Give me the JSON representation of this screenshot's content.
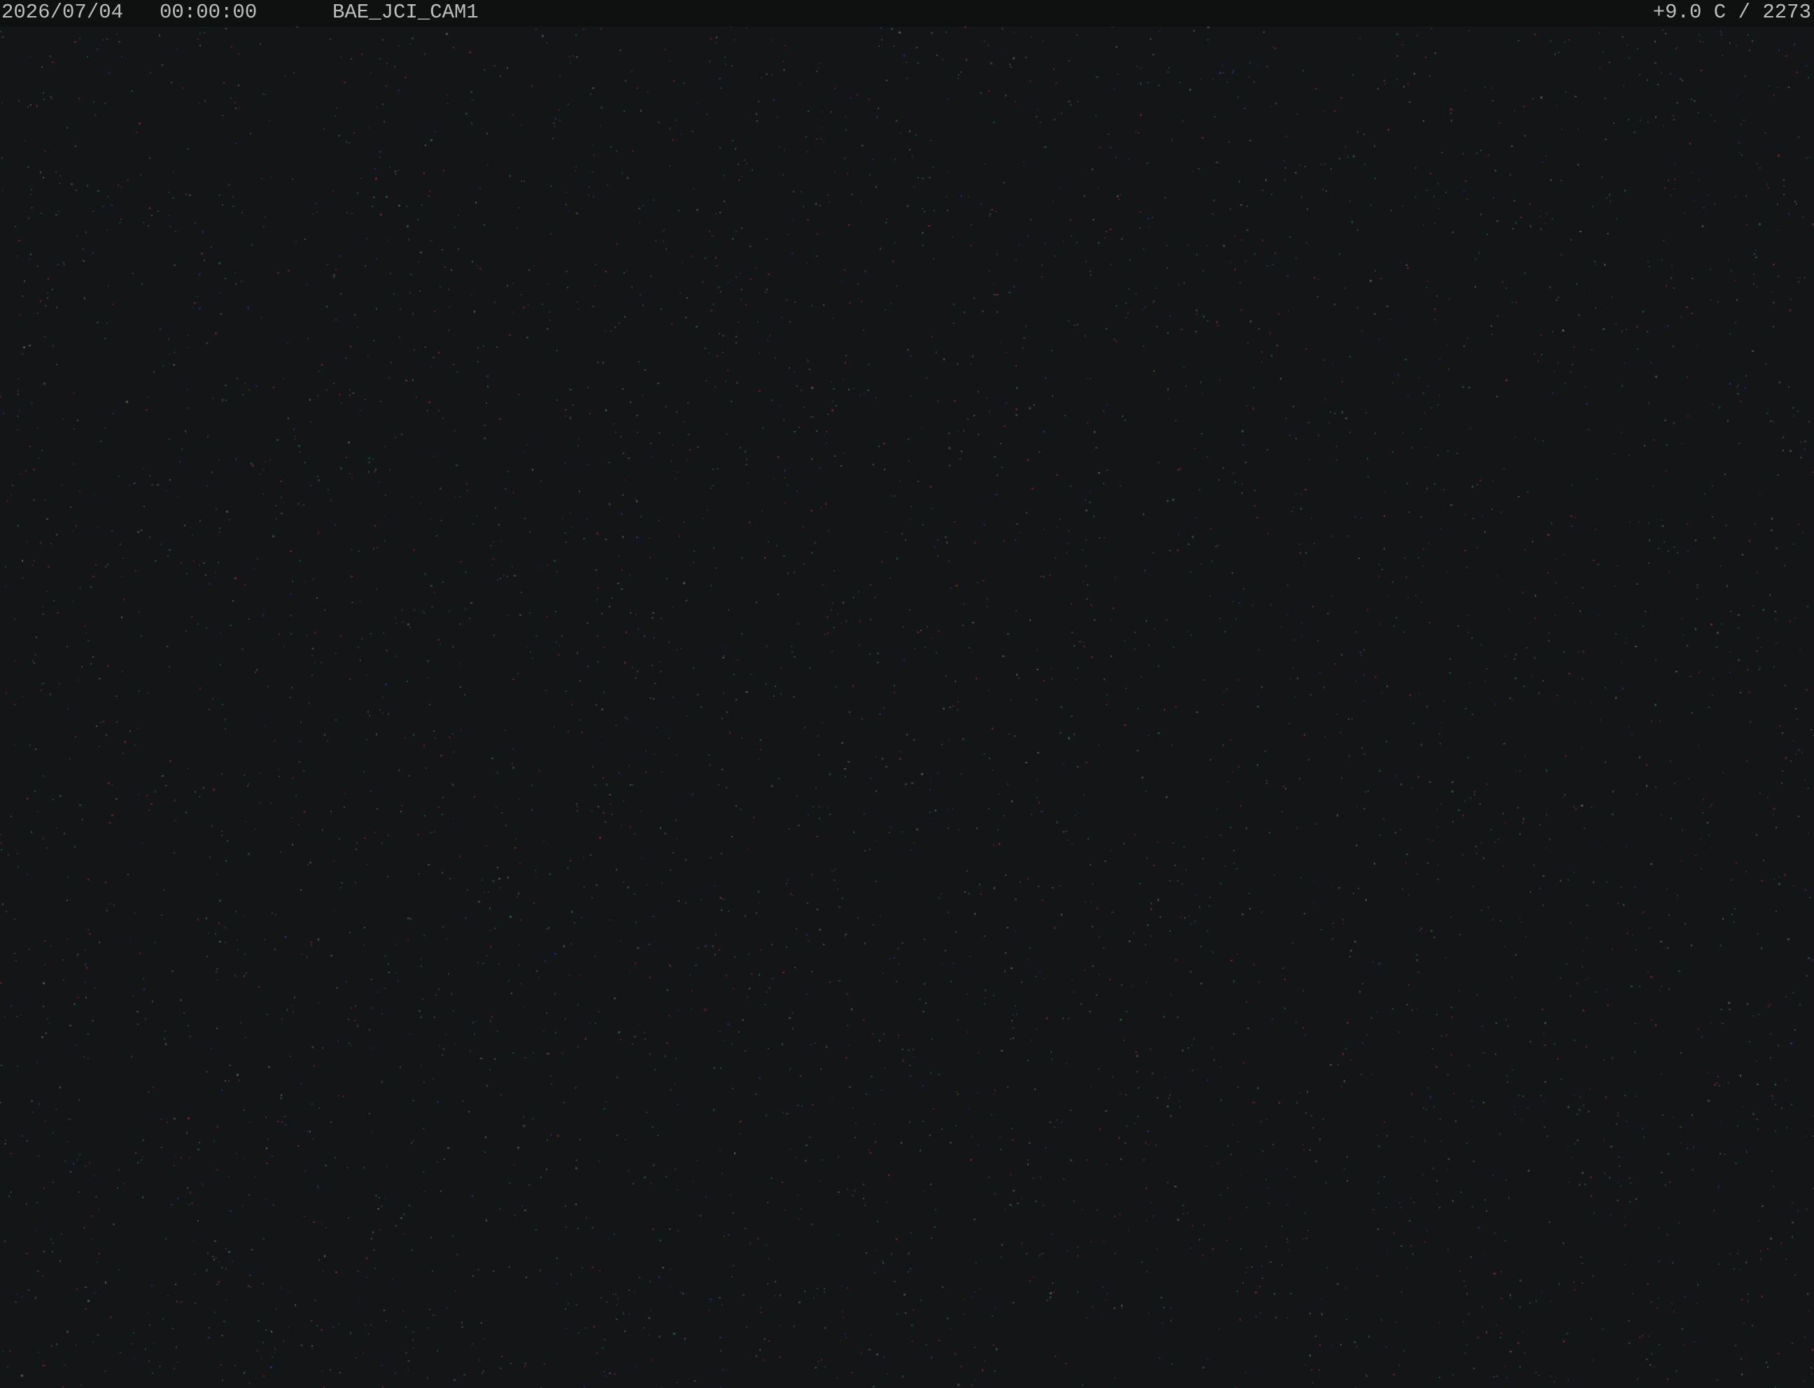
{
  "overlay": {
    "date": "2026/07/04",
    "time": "00:00:00",
    "camera_name": "BAE_JCI_CAM1",
    "status_readout": "+9.0 C / 2273"
  },
  "image": {
    "scene": "night-sky",
    "background_color": "#141516",
    "sensor_noise_colors": [
      "#7a2430",
      "#2b5a3a",
      "#2a2f7a",
      "#5a5a5a"
    ]
  }
}
